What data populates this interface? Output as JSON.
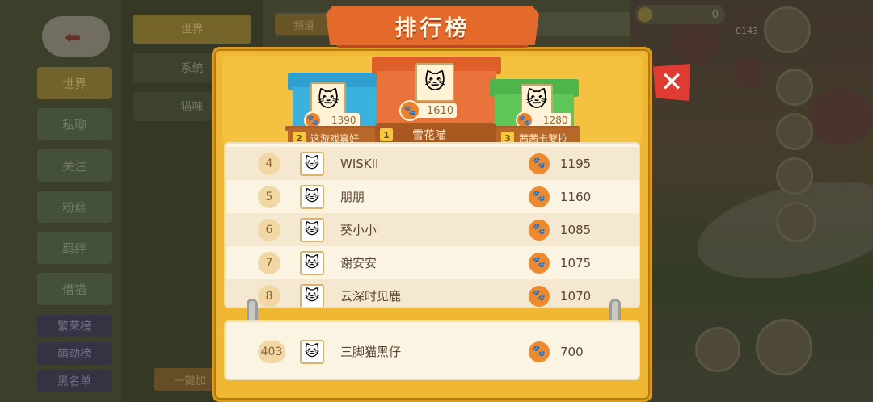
{
  "sidebar": {
    "items": [
      {
        "label": "世界",
        "active": true
      },
      {
        "label": "私聊"
      },
      {
        "label": "关注"
      },
      {
        "label": "粉丝"
      },
      {
        "label": "羁绊"
      },
      {
        "label": "借猫"
      }
    ],
    "special": [
      {
        "label": "繁荣榜"
      },
      {
        "label": "萌动榜"
      },
      {
        "label": "黑名单"
      }
    ]
  },
  "channels": {
    "tabs": [
      {
        "label": "世界",
        "active": true
      },
      {
        "label": "系统"
      },
      {
        "label": "猫咪"
      }
    ],
    "quick_button": "一键加"
  },
  "chat": {
    "top_button": "频道"
  },
  "hud": {
    "coins": "0",
    "small_number": "0143"
  },
  "ranking": {
    "title": "排行榜",
    "close_symbol": "✕",
    "podium": [
      {
        "rank": "2",
        "name": "这游戏真好",
        "score": "1390",
        "color": "blue",
        "avatar": "🐱"
      },
      {
        "rank": "1",
        "name": "雪花喵",
        "score": "1610",
        "color": "orange",
        "avatar": "🐱"
      },
      {
        "rank": "3",
        "name": "茜茜卡萝拉",
        "score": "1280",
        "color": "green",
        "avatar": "🐱"
      }
    ],
    "list": [
      {
        "rank": "4",
        "name": "WISKII",
        "score": "1195",
        "avatar": "🐱"
      },
      {
        "rank": "5",
        "name": "朋朋",
        "score": "1160",
        "avatar": "🐱"
      },
      {
        "rank": "6",
        "name": "葵小小",
        "score": "1085",
        "avatar": "🐱"
      },
      {
        "rank": "7",
        "name": "谢安安",
        "score": "1075",
        "avatar": "🐱"
      },
      {
        "rank": "8",
        "name": "云深时见鹿",
        "score": "1070",
        "avatar": "🐱"
      }
    ],
    "me": {
      "rank": "403",
      "name": "三脚猫黑仔",
      "score": "700",
      "avatar": "🐱"
    },
    "paw_icon": "🐾"
  },
  "colors": {
    "board": "#f0b733",
    "banner": "#e46a2b",
    "close": "#df3b30",
    "first": "#e9733a",
    "second": "#3bb2de",
    "third": "#5fc759"
  }
}
